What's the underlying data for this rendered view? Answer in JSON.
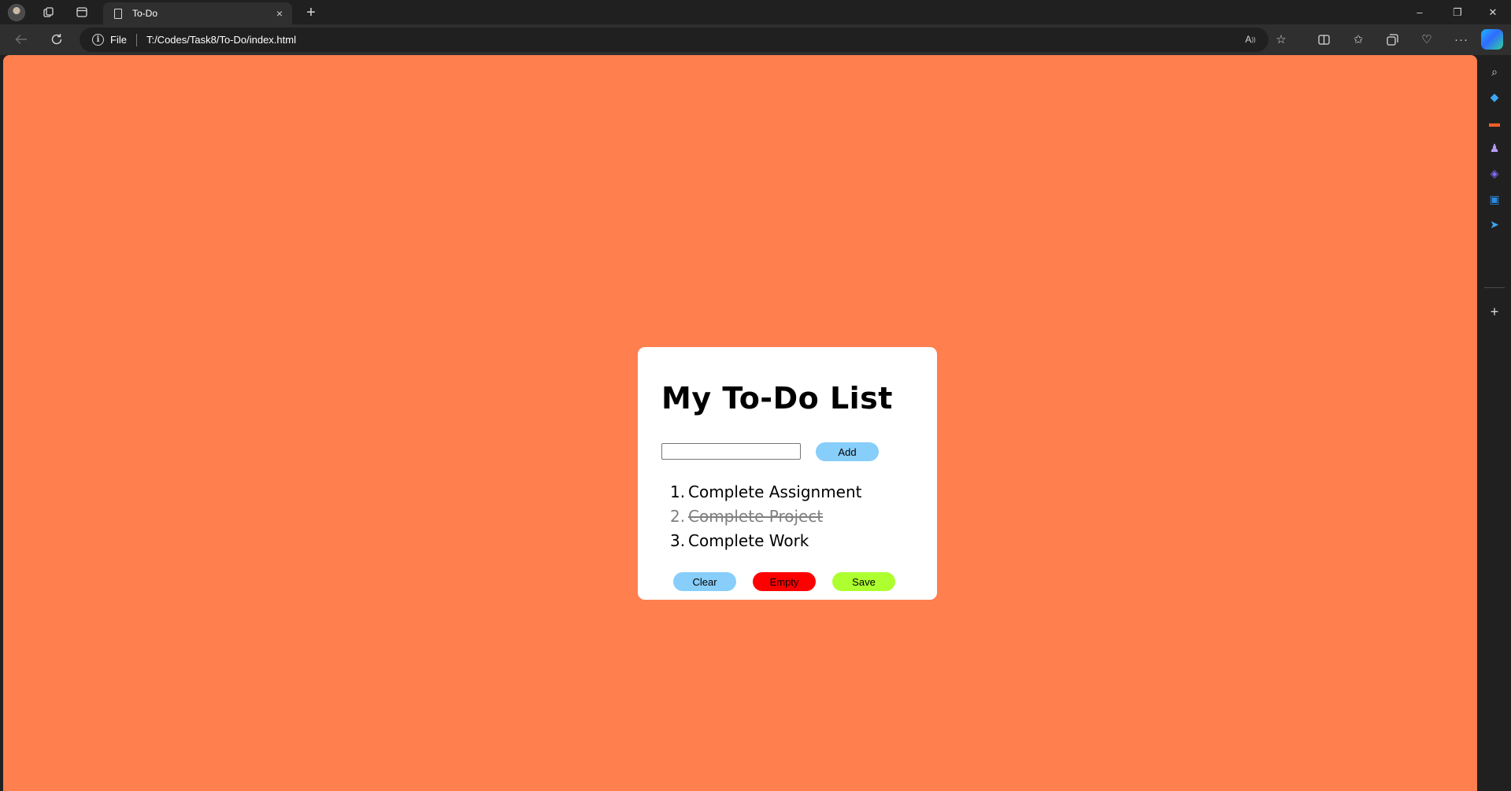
{
  "browser": {
    "tab": {
      "title": "To-Do",
      "close_icon": "×"
    },
    "new_tab_icon": "+",
    "window_controls": {
      "minimize": "–",
      "restore": "❐",
      "close": "✕"
    },
    "address": {
      "scheme_label": "File",
      "url": "T:/Codes/Task8/To-Do/index.html"
    }
  },
  "sidebar": {
    "icons": [
      {
        "name": "search-icon",
        "glyph": "⌕",
        "color": "#d6d6d6"
      },
      {
        "name": "shopping-tag-icon",
        "glyph": "◆",
        "color": "#3ba8f5"
      },
      {
        "name": "tools-briefcase-icon",
        "glyph": "▬",
        "color": "#f0602a"
      },
      {
        "name": "games-icon",
        "glyph": "♟",
        "color": "#b79cf5"
      },
      {
        "name": "copilot-app-icon",
        "glyph": "◈",
        "color": "#7e6cf5"
      },
      {
        "name": "outlook-icon",
        "glyph": "▣",
        "color": "#2a8be0"
      },
      {
        "name": "send-icon",
        "glyph": "➤",
        "color": "#3ba8f5"
      }
    ],
    "add_icon": "+"
  },
  "app": {
    "page_background": "#ff7f4f",
    "heading": "My To-Do List",
    "input": {
      "value": "",
      "placeholder": ""
    },
    "add_label": "Add",
    "tasks": [
      {
        "number": "1.",
        "text": "Complete Assignment",
        "done": false
      },
      {
        "number": "2.",
        "text": "Complete Project",
        "done": true
      },
      {
        "number": "3.",
        "text": "Complete Work",
        "done": false
      }
    ],
    "buttons": {
      "clear_label": "Clear",
      "empty_label": "Empty",
      "save_label": "Save",
      "add_color": "#87cefa",
      "clear_color": "#87cefa",
      "empty_color": "#ff0000",
      "save_color": "#adff2f"
    }
  }
}
